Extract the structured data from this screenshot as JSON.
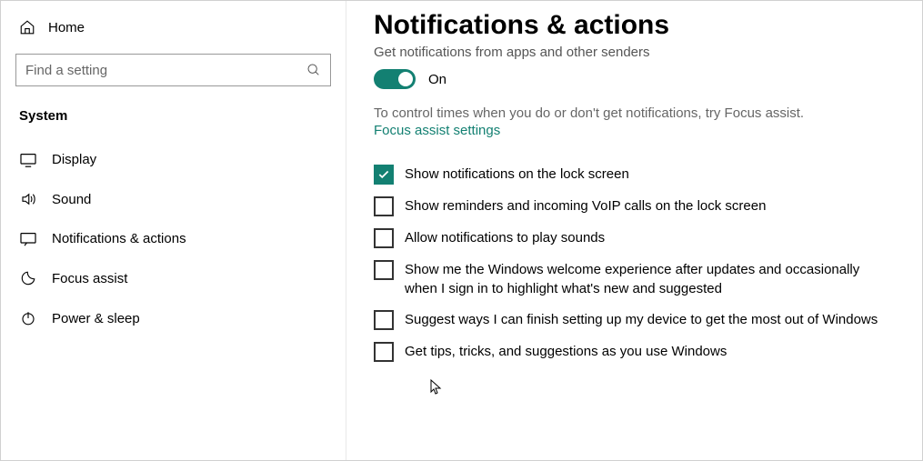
{
  "sidebar": {
    "home_label": "Home",
    "search_placeholder": "Find a setting",
    "category": "System",
    "items": [
      {
        "icon": "display",
        "label": "Display"
      },
      {
        "icon": "sound",
        "label": "Sound"
      },
      {
        "icon": "notifications",
        "label": "Notifications & actions"
      },
      {
        "icon": "focus",
        "label": "Focus assist"
      },
      {
        "icon": "power",
        "label": "Power & sleep"
      }
    ]
  },
  "main": {
    "title": "Notifications & actions",
    "sub_label": "Get notifications from apps and other senders",
    "toggle_state": "On",
    "helper_text": "To control times when you do or don't get notifications, try Focus assist.",
    "link_label": "Focus assist settings",
    "checkboxes": [
      {
        "checked": true,
        "label": "Show notifications on the lock screen"
      },
      {
        "checked": false,
        "label": "Show reminders and incoming VoIP calls on the lock screen"
      },
      {
        "checked": false,
        "label": "Allow notifications to play sounds"
      },
      {
        "checked": false,
        "label": "Show me the Windows welcome experience after updates and occasionally when I sign in to highlight what's new and suggested"
      },
      {
        "checked": false,
        "label": "Suggest ways I can finish setting up my device to get the most out of Windows"
      },
      {
        "checked": false,
        "label": "Get tips, tricks, and suggestions as you use Windows"
      }
    ]
  },
  "colors": {
    "accent": "#138072"
  }
}
